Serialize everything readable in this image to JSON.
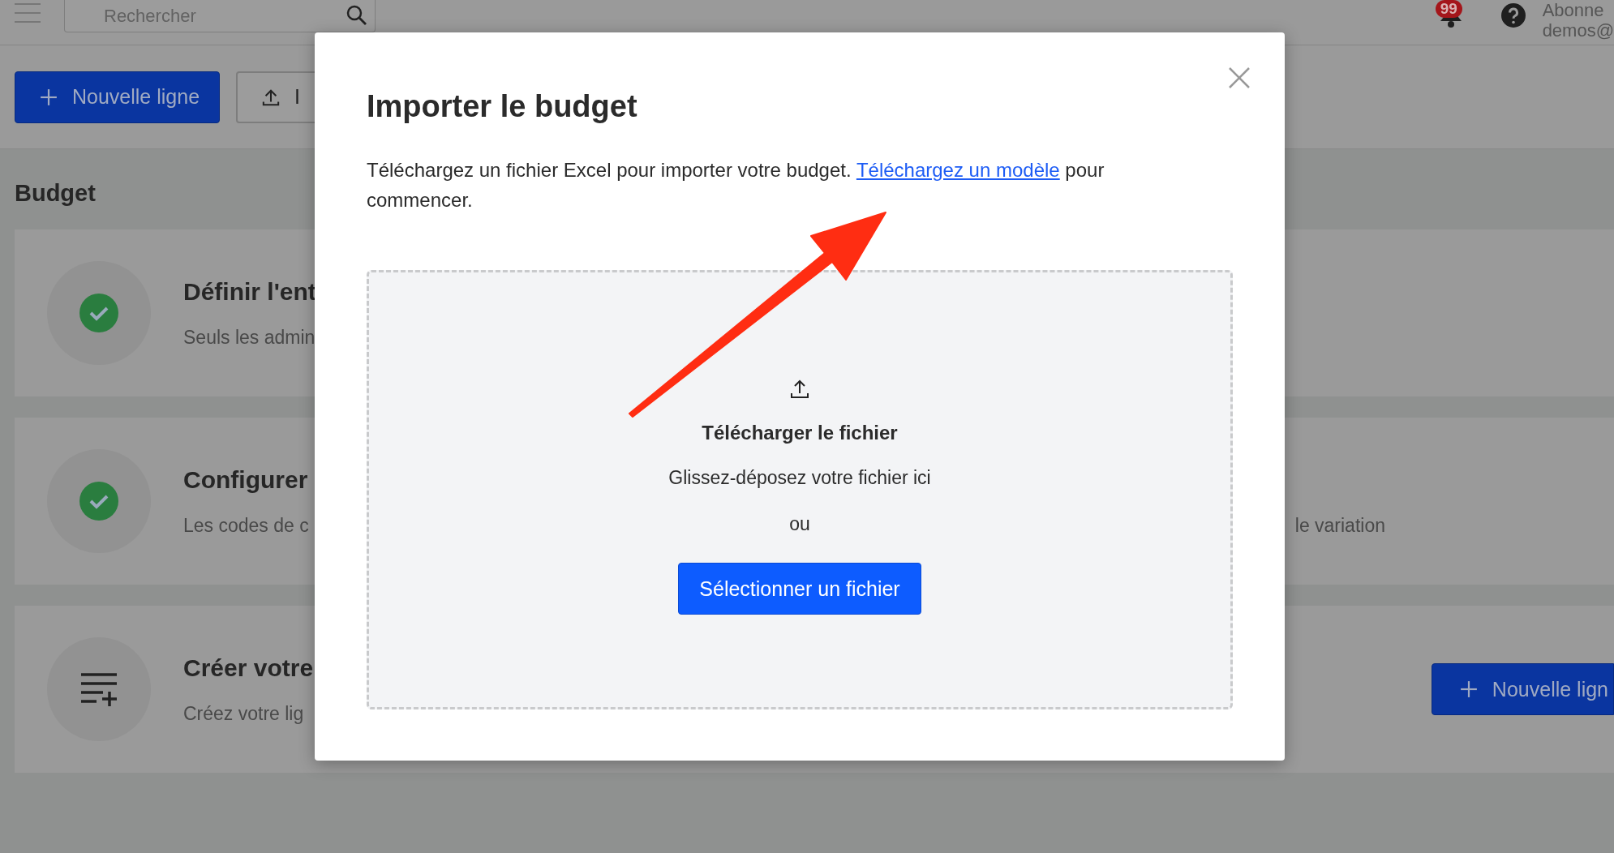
{
  "topbar": {
    "search": {
      "placeholder": "Rechercher"
    },
    "notifications_badge": "99",
    "account": {
      "line_1": "Abonne",
      "line_2": "demos@"
    }
  },
  "toolbar": {
    "buttons": [
      {
        "label": "Nouvelle ligne",
        "kind": "primary"
      },
      {
        "label": "I",
        "kind": "secondary"
      }
    ]
  },
  "page": {
    "title": "Budget",
    "steps": [
      {
        "kind": "done",
        "title": "Définir l'ent",
        "description": "Seuls les admin"
      },
      {
        "kind": "done",
        "title": "Configurer",
        "description": "Les codes de c",
        "description_end": "le variation"
      },
      {
        "kind": "todo",
        "title": "Créer votre",
        "description": "Créez votre lig",
        "action": "Nouvelle lign"
      }
    ]
  },
  "modal": {
    "title": "Importer le budget",
    "text_before": "Téléchargez un fichier Excel pour importer votre budget.",
    "link": "Téléchargez un modèle",
    "text_after": "pour commencer.",
    "dropzone": {
      "title": "Télécharger le fichier",
      "hint": "Glissez-déposez votre fichier ici",
      "separator": "ou",
      "button": "Sélectionner un fichier"
    }
  }
}
